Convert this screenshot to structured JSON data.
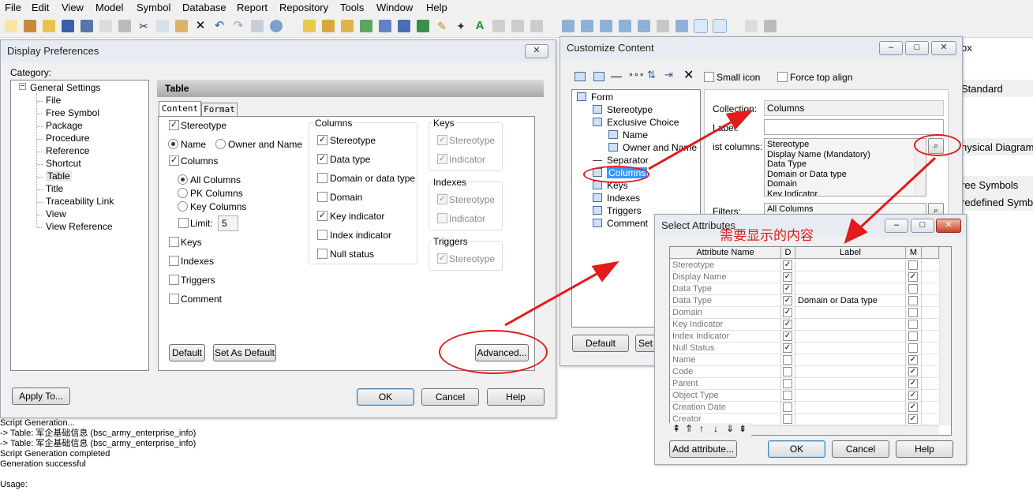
{
  "menu": [
    "File",
    "Edit",
    "View",
    "Model",
    "Symbol",
    "Database",
    "Report",
    "Repository",
    "Tools",
    "Window",
    "Help"
  ],
  "right_panel": {
    "title": "ox",
    "standard": "Standard",
    "physical": "hysical Diagram",
    "free": "ree Symbols",
    "predefined": "redefined Symb"
  },
  "output_lines": [
    "Script Generation...",
    "-> Table: 军企基础信息 (bsc_army_enterprise_info)",
    "-> Table: 军企基础信息 (bsc_army_enterprise_info)",
    "Script Generation completed",
    "Generation successful",
    "",
    "Usage:"
  ],
  "display_prefs": {
    "title": "Display Preferences",
    "category_label": "Category:",
    "tree_root": "General Settings",
    "tree_items": [
      "File",
      "Free Symbol",
      "Package",
      "Procedure",
      "Reference",
      "Shortcut",
      "Table",
      "Title",
      "Traceability Link",
      "View",
      "View Reference"
    ],
    "selected_item": "Table",
    "section_title": "Table",
    "tabs": [
      "Content",
      "Format"
    ],
    "stereotype": "Stereotype",
    "name": "Name",
    "owner_and_name": "Owner and Name",
    "columns": "Columns",
    "all_columns": "All Columns",
    "pk_columns": "PK Columns",
    "key_columns": "Key Columns",
    "limit_label": "Limit:",
    "limit_value": "5",
    "keys": "Keys",
    "indexes": "Indexes",
    "triggers": "Triggers",
    "comment": "Comment",
    "columns_group": {
      "title": "Columns",
      "items": [
        {
          "label": "Stereotype",
          "checked": true
        },
        {
          "label": "Data type",
          "checked": true
        },
        {
          "label": "Domain or data type",
          "checked": false
        },
        {
          "label": "Domain",
          "checked": false
        },
        {
          "label": "Key indicator",
          "checked": true
        },
        {
          "label": "Index indicator",
          "checked": false
        },
        {
          "label": "Null status",
          "checked": false
        }
      ]
    },
    "keys_group": {
      "title": "Keys",
      "stereotype": "Stereotype",
      "indicator": "Indicator"
    },
    "indexes_group": {
      "title": "Indexes",
      "stereotype": "Stereotype",
      "indicator": "Indicator"
    },
    "triggers_group": {
      "title": "Triggers",
      "stereotype": "Stereotype"
    },
    "default_btn": "Default",
    "set_default_btn": "Set As Default",
    "advanced_btn": "Advanced...",
    "apply_to_btn": "Apply To...",
    "ok_btn": "OK",
    "cancel_btn": "Cancel",
    "help_btn": "Help"
  },
  "customize": {
    "title": "Customize Content",
    "small_icon": "Small icon",
    "force_top_align": "Force top align",
    "tree": [
      "Form",
      "Stereotype",
      "Exclusive Choice",
      "Name",
      "Owner and Name",
      "Separator",
      "Columns",
      "Keys",
      "Indexes",
      "Triggers",
      "Comment"
    ],
    "collection_label": "Collection:",
    "collection_value": "Columns",
    "label_label": "Label:",
    "list_columns_label": "ist columns:",
    "list_columns": [
      "Stereotype",
      "Display Name (Mandatory)",
      "Data Type",
      "Domain or Data type",
      "Domain",
      "Key Indicator"
    ],
    "filters_label": "Filters:",
    "filters_value": "All Columns",
    "default_btn": "Default",
    "set_btn": "Set A"
  },
  "select_attrs": {
    "title": "Select Attributes",
    "annotation": "需要显示的内容",
    "headers": [
      "Attribute Name",
      "D",
      "Label",
      "M"
    ],
    "rows": [
      {
        "name": "Stereotype",
        "d": true,
        "label": "",
        "m": false
      },
      {
        "name": "Display Name",
        "d": true,
        "label": "",
        "m": true
      },
      {
        "name": "Data Type",
        "d": true,
        "label": "",
        "m": false
      },
      {
        "name": "Data Type",
        "d": true,
        "label": "Domain or Data type",
        "m": false
      },
      {
        "name": "Domain",
        "d": true,
        "label": "",
        "m": false
      },
      {
        "name": "Key Indicator",
        "d": true,
        "label": "",
        "m": false
      },
      {
        "name": "Index Indicator",
        "d": true,
        "label": "",
        "m": false
      },
      {
        "name": "Null Status",
        "d": true,
        "label": "",
        "m": false
      },
      {
        "name": "Name",
        "d": false,
        "label": "",
        "m": true
      },
      {
        "name": "Code",
        "d": false,
        "label": "",
        "m": true
      },
      {
        "name": "Parent",
        "d": false,
        "label": "",
        "m": true
      },
      {
        "name": "Object Type",
        "d": false,
        "label": "",
        "m": true
      },
      {
        "name": "Creation Date",
        "d": false,
        "label": "",
        "m": true
      },
      {
        "name": "Creator",
        "d": false,
        "label": "",
        "m": true
      }
    ],
    "add_attribute_btn": "Add attribute...",
    "ok_btn": "OK",
    "cancel_btn": "Cancel",
    "help_btn": "Help"
  },
  "colors": {
    "accent": "#e21b1b",
    "selection": "#3399ff"
  }
}
